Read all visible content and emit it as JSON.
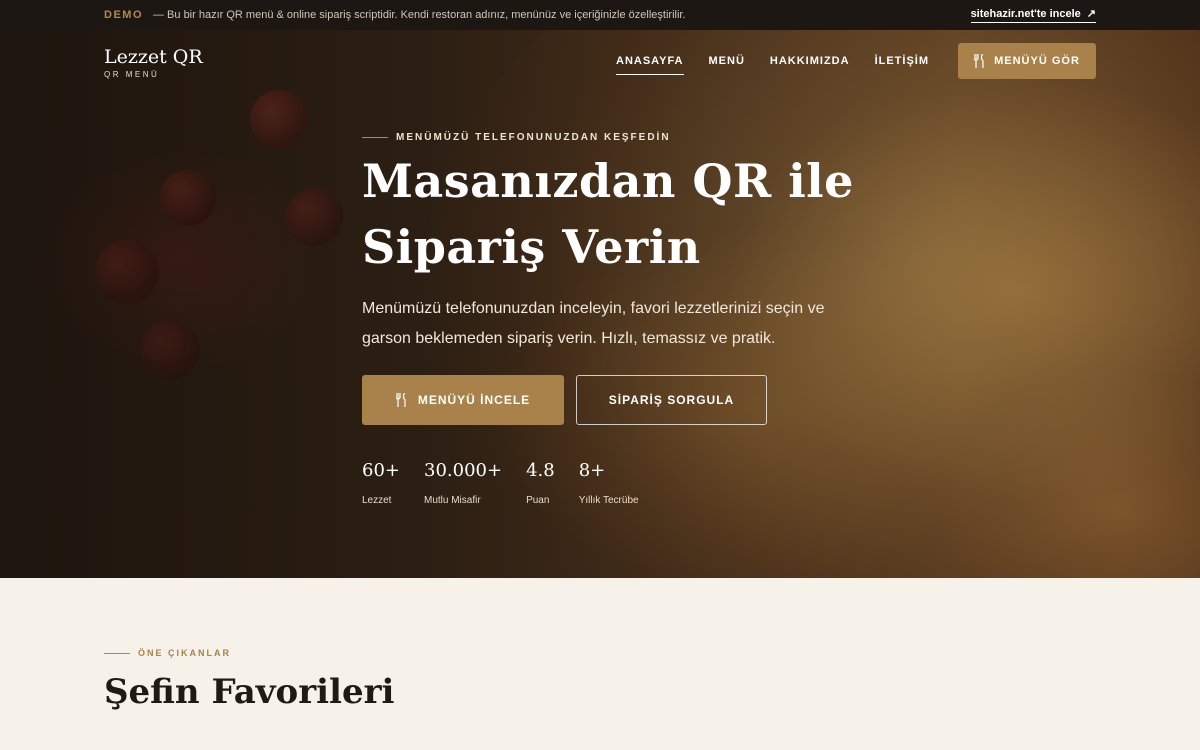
{
  "demo_bar": {
    "tag": "DEMO",
    "text": "— Bu bir hazır QR menü & online sipariş scriptidir. Kendi restoran adınız, menünüz ve içeriğinizle özelleştirilir.",
    "link": "sitehazir.net'te incele",
    "link_icon": "↗"
  },
  "nav": {
    "logo_name": "Lezzet QR",
    "logo_sub": "QR MENÜ",
    "links": [
      "ANASAYFA",
      "MENÜ",
      "HAKKIMIZDA",
      "İLETİŞİM"
    ],
    "cta_label": "MENÜYÜ GÖR",
    "cta_icon": "fork-knife-icon"
  },
  "hero": {
    "eyebrow": "MENÜMÜZÜ TELEFONUNUZDAN KEŞFEDİN",
    "headline": "Masanızdan QR ile Sipariş Verin",
    "subtext": "Menümüzü telefonunuzdan inceleyin, favori lezzetlerinizi seçin ve garson beklemeden sipariş verin. Hızlı, temassız ve pratik.",
    "primary_button": "MENÜYÜ İNCELE",
    "secondary_button": "SİPARİŞ SORGULA",
    "stats": [
      {
        "value": "60+",
        "label": "Lezzet"
      },
      {
        "value": "30.000+",
        "label": "Mutlu Misafir"
      },
      {
        "value": "4.8",
        "label": "Puan"
      },
      {
        "value": "8+",
        "label": "Yıllık Tecrübe"
      }
    ]
  },
  "section": {
    "eyebrow": "ÖNE ÇIKANLAR",
    "title": "Şefin Favorileri"
  },
  "colors": {
    "accent": "#a8824a",
    "dark_bar": "#1c1712",
    "background": "#f6f2ea"
  }
}
